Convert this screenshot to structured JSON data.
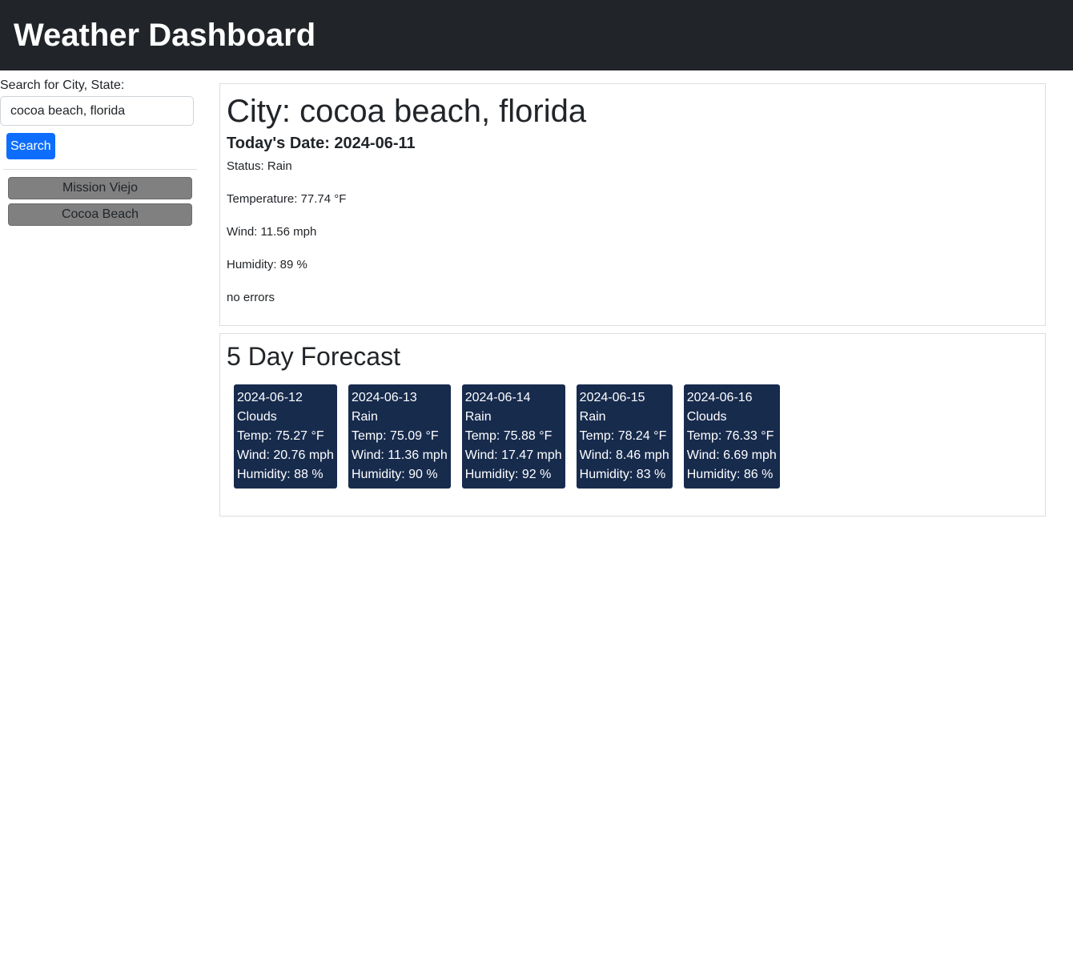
{
  "header": {
    "title": "Weather Dashboard"
  },
  "sidebar": {
    "search_label": "Search for City, State:",
    "search_value": "cocoa beach, florida",
    "search_button": "Search",
    "history": [
      "Mission Viejo",
      "Cocoa Beach"
    ]
  },
  "current": {
    "city": "City: cocoa beach, florida",
    "date": "Today's Date: 2024-06-11",
    "status": "Status: Rain",
    "temperature": "Temperature: 77.74 °F",
    "wind": "Wind: 11.56 mph",
    "humidity": "Humidity: 89 %",
    "errors": "no errors"
  },
  "forecast": {
    "title": "5 Day Forecast",
    "days": [
      {
        "date": "2024-06-12",
        "status": "Clouds",
        "temp": "Temp: 75.27 °F",
        "wind": "Wind: 20.76 mph",
        "humidity": "Humidity: 88 %"
      },
      {
        "date": "2024-06-13",
        "status": "Rain",
        "temp": "Temp: 75.09 °F",
        "wind": "Wind: 11.36 mph",
        "humidity": "Humidity: 90 %"
      },
      {
        "date": "2024-06-14",
        "status": "Rain",
        "temp": "Temp: 75.88 °F",
        "wind": "Wind: 17.47 mph",
        "humidity": "Humidity: 92 %"
      },
      {
        "date": "2024-06-15",
        "status": "Rain",
        "temp": "Temp: 78.24 °F",
        "wind": "Wind: 8.46 mph",
        "humidity": "Humidity: 83 %"
      },
      {
        "date": "2024-06-16",
        "status": "Clouds",
        "temp": "Temp: 76.33 °F",
        "wind": "Wind: 6.69 mph",
        "humidity": "Humidity: 86 %"
      }
    ]
  },
  "colors": {
    "header_bg": "#212529",
    "primary": "#0d6efd",
    "card_bg": "#172b4d",
    "history_bg": "#808080"
  }
}
